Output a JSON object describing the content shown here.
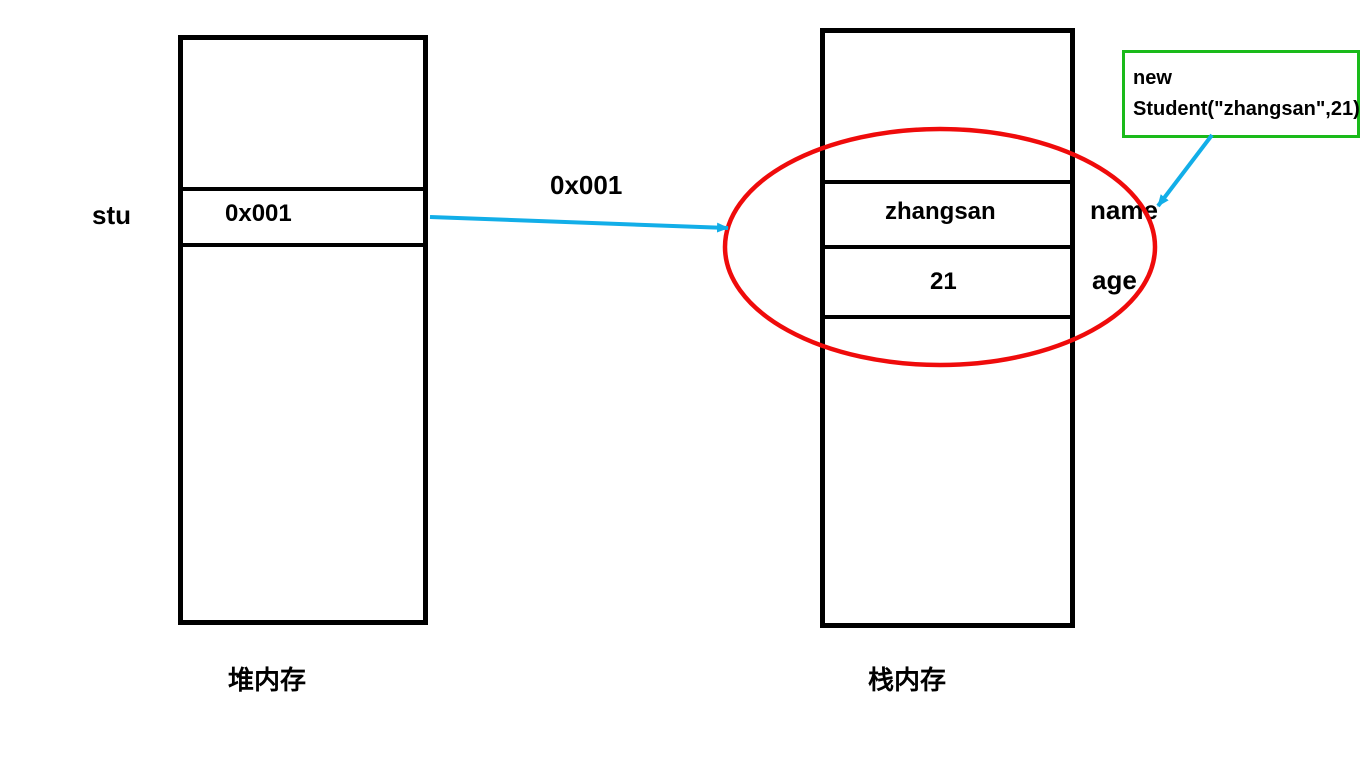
{
  "left": {
    "varName": "stu",
    "cellValue": "0x001",
    "caption": "堆内存"
  },
  "arrow": {
    "label": "0x001"
  },
  "right": {
    "row1Value": "zhangsan",
    "row1Label": "name",
    "row2Value": "21",
    "row2Label": "age",
    "caption": "栈内存"
  },
  "codeBox": {
    "line1": "new",
    "line2": "Student(\"zhangsan\",21)"
  }
}
